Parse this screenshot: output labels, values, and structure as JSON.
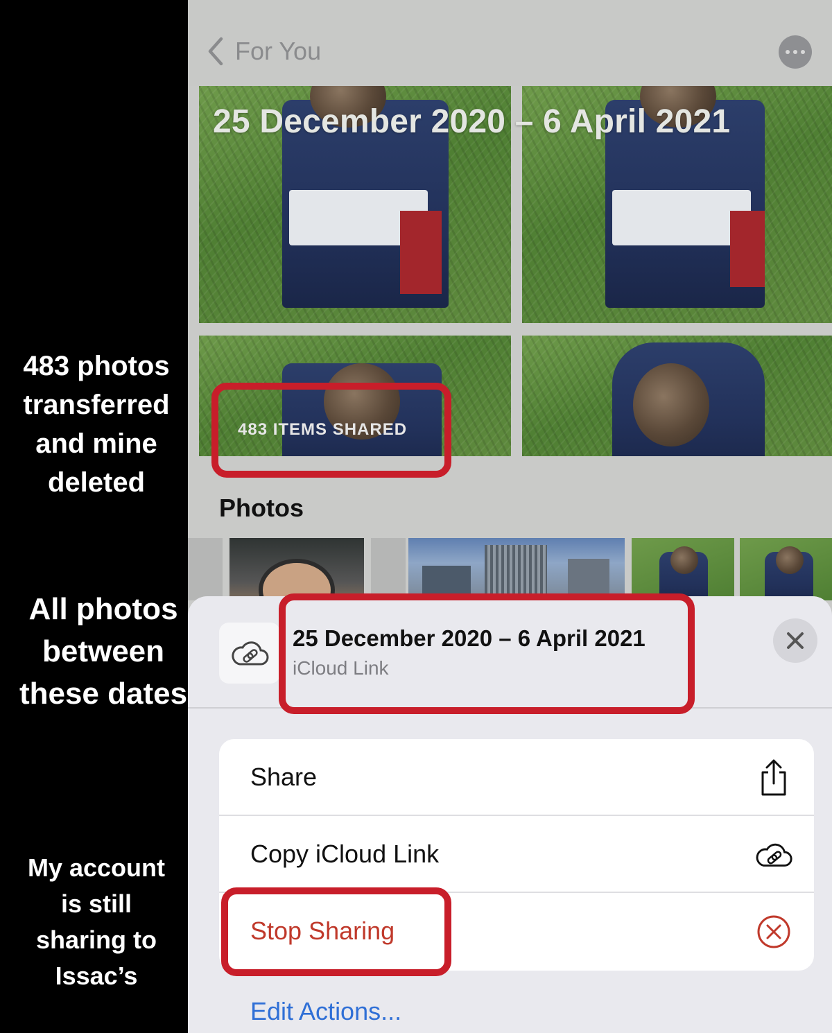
{
  "annotations": {
    "note1": [
      "483 photos",
      "transferred",
      "and mine",
      "deleted"
    ],
    "note2": [
      "All photos",
      "between",
      "these dates"
    ],
    "note3": [
      "My account",
      "is still",
      "sharing to",
      "Issac’s"
    ]
  },
  "navbar": {
    "back_label": "For You"
  },
  "memory": {
    "title": "25 December 2020 – 6 April 2021",
    "items_shared": "483 ITEMS SHARED"
  },
  "photos_section": {
    "title": "Photos"
  },
  "sheet": {
    "title": "25 December 2020 – 6 April 2021",
    "subtitle": "iCloud Link",
    "actions": [
      {
        "label": "Share",
        "icon": "share-icon"
      },
      {
        "label": "Copy iCloud Link",
        "icon": "icloud-link-icon"
      },
      {
        "label": "Stop Sharing",
        "icon": "stop-circle-icon"
      }
    ],
    "edit_actions": "Edit Actions..."
  },
  "colors": {
    "highlight": "#c81e2a",
    "destructive": "#c0392b",
    "link_blue": "#2f6fd6"
  }
}
